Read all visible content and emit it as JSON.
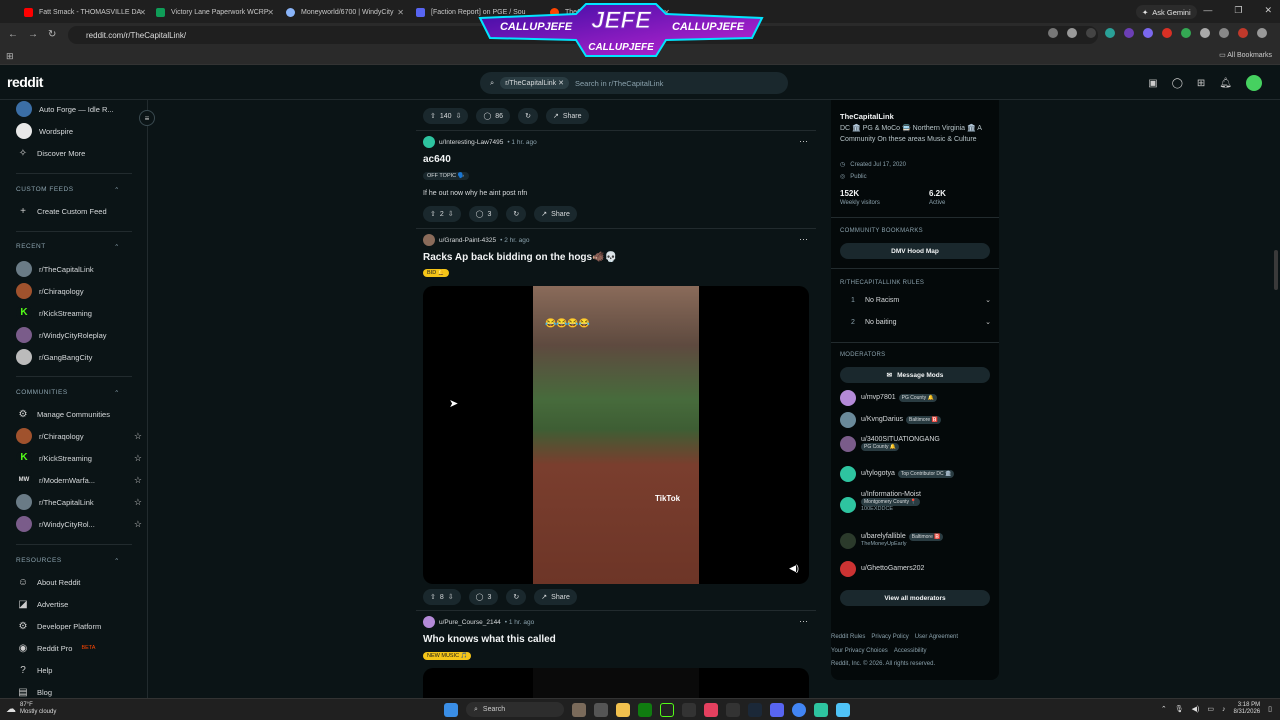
{
  "browser": {
    "tabs": [
      {
        "title": "Fatt Smack - THOMASVILLE DA",
        "color": "#ff0000"
      },
      {
        "title": "Victory Lane Paperwork WCRP",
        "color": "#0f9d58"
      },
      {
        "title": "Moneyworld/6700 | WindyCity",
        "color": "#8ab4f8"
      },
      {
        "title": "[Faction Report] on PGE / Sou",
        "color": "#5865f2"
      },
      {
        "title": "TheCapi",
        "color": "#ff4500"
      }
    ],
    "ask_gemini": "Ask Gemini",
    "url": "reddit.com/r/TheCapitalLink/",
    "all_bookmarks": "All Bookmarks"
  },
  "overlay": {
    "title": "JEFE",
    "left": "CALLUPJEFE",
    "right": "CALLUPJEFE",
    "bottom": "CALLUPJEFE"
  },
  "header": {
    "logo": "reddit",
    "search_chip": "r/TheCapitalLink",
    "search_placeholder": "Search in r/TheCapitalLink"
  },
  "sidebar": {
    "top_items": [
      {
        "label": "Auto Forge — Idle R...",
        "color": "#3b6ea5"
      },
      {
        "label": "Wordspire",
        "color": "#e8e8e8"
      },
      {
        "label": "Discover More",
        "icon": "compass"
      }
    ],
    "custom_feeds_header": "CUSTOM FEEDS",
    "create_custom_feed": "Create Custom Feed",
    "recent_header": "RECENT",
    "recent": [
      {
        "label": "r/TheCapitalLink",
        "color": "#6a7b86"
      },
      {
        "label": "r/Chiraqology",
        "color": "#a0522d"
      },
      {
        "label": "r/KickStreaming",
        "color": "#53fc18"
      },
      {
        "label": "r/WindyCityRoleplay",
        "color": "#7a5c8a"
      },
      {
        "label": "r/GangBangCity",
        "color": "#bbbbbb"
      }
    ],
    "communities_header": "COMMUNITIES",
    "manage_communities": "Manage Communities",
    "communities": [
      {
        "label": "r/Chiraqology",
        "color": "#a0522d"
      },
      {
        "label": "r/KickStreaming",
        "color": "#53fc18"
      },
      {
        "label": "r/ModernWarfa...",
        "color": "#dddddd"
      },
      {
        "label": "r/TheCapitalLink",
        "color": "#6a7b86"
      },
      {
        "label": "r/WindyCityRol...",
        "color": "#7a5c8a"
      }
    ],
    "resources_header": "RESOURCES",
    "resources": [
      {
        "label": "About Reddit"
      },
      {
        "label": "Advertise"
      },
      {
        "label": "Developer Platform"
      },
      {
        "label": "Reddit Pro",
        "badge": "BETA"
      },
      {
        "label": "Help"
      },
      {
        "label": "Blog"
      }
    ]
  },
  "feed": {
    "top_actions": {
      "votes": "140",
      "comments": "86",
      "share": "Share"
    },
    "posts": [
      {
        "author": "u/Interesting-Law7495",
        "time": "1 hr. ago",
        "title": "ac640",
        "flair": "OFF TOPIC 🗣️",
        "text": "If he out now why he aint post nfn",
        "votes": "2",
        "comments": "3",
        "share": "Share"
      },
      {
        "author": "u/Grand-Paint-4325",
        "time": "2 hr. ago",
        "title": "Racks Ap back bidding on the hogs🐗💀",
        "flair": "BID 🔔",
        "video_watermark": "TikTok",
        "video_emojis": "😂😂😂😂",
        "votes": "8",
        "comments": "3",
        "share": "Share"
      },
      {
        "author": "u/Pure_Course_2144",
        "time": "1 hr. ago",
        "title": "Who knows what this called",
        "flair": "NEW MUSIC 🎵"
      }
    ]
  },
  "community": {
    "name": "TheCapitalLink",
    "description": "DC 🏛️ PG & MoCo 🚍 Northern Virginia 🏛️ A Community On these areas Music & Culture",
    "created": "Created Jul 17, 2020",
    "visibility": "Public",
    "weekly_visitors": "152K",
    "weekly_visitors_label": "Weekly visitors",
    "active": "6.2K",
    "active_label": "Active",
    "bookmarks_header": "COMMUNITY BOOKMARKS",
    "bookmark_button": "DMV Hood Map",
    "rules_header": "R/THECAPITALLINK RULES",
    "rules": [
      {
        "num": "1",
        "text": "No Racism"
      },
      {
        "num": "2",
        "text": "No baiting"
      }
    ],
    "moderators_header": "MODERATORS",
    "message_mods": "Message Mods",
    "moderators": [
      {
        "name": "u/mvp7801",
        "flair": "PG County 🔔",
        "color": "#b48ad8"
      },
      {
        "name": "u/KvngDarius",
        "flair": "Baltimore 🅱️",
        "color": "#6a8a9a"
      },
      {
        "name": "u/3400SITUATIONGANG",
        "flair": "PG County 🔔",
        "color": "#7a5c8a"
      },
      {
        "name": "u/tylogotya",
        "flair": "Top Contributor DC 🏛️",
        "color": "#2ec4a0"
      },
      {
        "name": "u/Information-Moist",
        "flair": "Montgomery County 📍",
        "sub": "100EXDDCE",
        "color": "#2ec4a0"
      },
      {
        "name": "u/barelyfallible",
        "flair": "Baltimore 🅱️",
        "sub": "TheMoneyUpEarly",
        "color": "#2b3a2b"
      },
      {
        "name": "u/GhettoGamers202",
        "color": "#cc3333"
      }
    ],
    "view_all_mods": "View all moderators"
  },
  "footer": {
    "links_row1": [
      "Reddit Rules",
      "Privacy Policy",
      "User Agreement"
    ],
    "links_row2": [
      "Your Privacy Choices",
      "Accessibility"
    ],
    "copyright": "Reddit, Inc. © 2026. All rights reserved."
  },
  "taskbar": {
    "temp": "87°F",
    "weather": "Mostly cloudy",
    "search": "Search",
    "time": "3:18 PM",
    "date": "8/31/2026"
  }
}
